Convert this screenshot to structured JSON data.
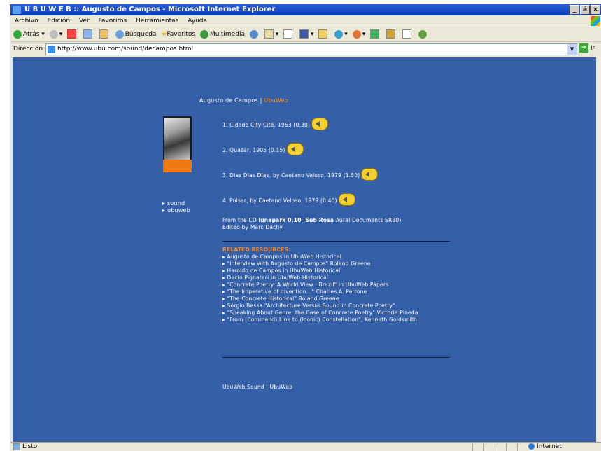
{
  "window": {
    "title": "U B U W E B :: Augusto de Campos - Microsoft Internet Explorer",
    "controls": [
      "_",
      "á",
      "×"
    ]
  },
  "menu": [
    "Archivo",
    "Edición",
    "Ver",
    "Favoritos",
    "Herramientas",
    "Ayuda"
  ],
  "toolbar": {
    "back_label": "Atrás",
    "search_label": "Búsqueda",
    "favorites_label": "Favoritos",
    "multimedia_label": "Multimedia"
  },
  "address": {
    "label": "Dirección",
    "url": "http://www.ubu.com/sound/decampos.html",
    "go_label": "Ir"
  },
  "page": {
    "header": {
      "name": "Augusto de Campos",
      "sep": "|",
      "link": "UbuWeb"
    },
    "tracks": [
      "1. Cidade City Cité, 1963 (0.30)",
      "2. Quazar, 1905 (0.15)",
      "3. Dias Dias Dias, by Caetano Veloso, 1979 (1.50)",
      "4. Pulsar, by Caetano Veloso, 1979 (0.40)"
    ],
    "side_nav": [
      "▸ sound",
      "▸ ubuweb"
    ],
    "from": {
      "prefix": "From the CD ",
      "album": "lunapark 0,10",
      "label_open": " (",
      "label": "Sub Rosa",
      "label_rest": " Aural Documents SR80)",
      "edited": "Edited by Marc Dachy"
    },
    "related_heading": "RELATED RESOURCES:",
    "related": [
      "▸ Augusto de Campos in UbuWeb Historical",
      "▸ \"Interview with Augusto de Campos\" Roland Greene",
      "▸ Haroldo de Campos in UbuWeb Historical",
      "▸ Decio Pignatari in UbuWeb Historical",
      "▸ \"Concrete Poetry: A World View : Brazil\" in UbuWeb Papers",
      "▸ \"The Imperative of Invention...\" Charles A. Perrone",
      "▸ \"The Concrete Historical\" Roland Greene",
      "▸ Sérgio Bessa \"Architecture Versus Sound in Concrete Poetry\"",
      "▸ \"Speaking About Genre: the Case of Concrete Poetry\" Victoria Pineda",
      "▸ \"From (Command) Line to (Iconic) Constellation\", Kenneth Goldsmith"
    ],
    "footer": "UbuWeb Sound | UbuWeb"
  },
  "status": {
    "left": "Listo",
    "zone": "Internet"
  }
}
